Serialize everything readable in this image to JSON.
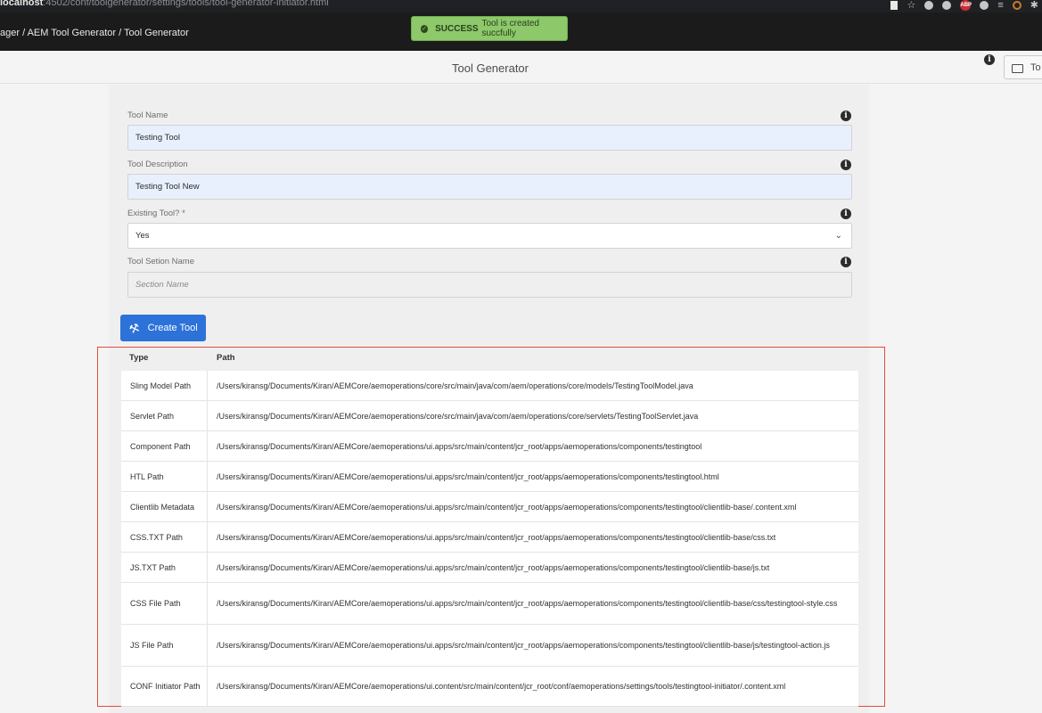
{
  "browser": {
    "url_host": "localhost",
    "url_rest": ":4502/conf/toolgenerator/settings/tools/tool-generator-initiator.html"
  },
  "nav": {
    "breadcrumb": "ager / AEM Tool Generator / Tool Generator"
  },
  "toast": {
    "title": "SUCCESS",
    "message": "Tool is created succfully"
  },
  "header": {
    "title": "Tool Generator",
    "tools_label": "To"
  },
  "form": {
    "tool_name_label": "Tool Name",
    "tool_name_value": "Testing Tool",
    "tool_description_label": "Tool Description",
    "tool_description_value": "Testing Tool New",
    "existing_tool_label": "Existing Tool? *",
    "existing_tool_value": "Yes",
    "section_name_label": "Tool Setion Name",
    "section_name_placeholder": "Section Name",
    "create_button_label": "Create Tool"
  },
  "table": {
    "columns": [
      "Type",
      "Path"
    ],
    "rows": [
      {
        "type": "Sling Model Path",
        "path": "/Users/kiransg/Documents/Kiran/AEMCore/aemoperations/core/src/main/java/com/aem/operations/core/models/TestingToolModel.java"
      },
      {
        "type": "Servlet Path",
        "path": "/Users/kiransg/Documents/Kiran/AEMCore/aemoperations/core/src/main/java/com/aem/operations/core/servlets/TestingToolServlet.java"
      },
      {
        "type": "Component Path",
        "path": "/Users/kiransg/Documents/Kiran/AEMCore/aemoperations/ui.apps/src/main/content/jcr_root/apps/aemoperations/components/testingtool"
      },
      {
        "type": "HTL Path",
        "path": "/Users/kiransg/Documents/Kiran/AEMCore/aemoperations/ui.apps/src/main/content/jcr_root/apps/aemoperations/components/testingtool.html"
      },
      {
        "type": "Clientlib Metadata",
        "path": "/Users/kiransg/Documents/Kiran/AEMCore/aemoperations/ui.apps/src/main/content/jcr_root/apps/aemoperations/components/testingtool/clientlib-base/.content.xml"
      },
      {
        "type": "CSS.TXT Path",
        "path": "/Users/kiransg/Documents/Kiran/AEMCore/aemoperations/ui.apps/src/main/content/jcr_root/apps/aemoperations/components/testingtool/clientlib-base/css.txt"
      },
      {
        "type": "JS.TXT Path",
        "path": "/Users/kiransg/Documents/Kiran/AEMCore/aemoperations/ui.apps/src/main/content/jcr_root/apps/aemoperations/components/testingtool/clientlib-base/js.txt"
      },
      {
        "type": "CSS File Path",
        "path": "/Users/kiransg/Documents/Kiran/AEMCore/aemoperations/ui.apps/src/main/content/jcr_root/apps/aemoperations/components/testingtool/clientlib-base/css/testingtool-style.css"
      },
      {
        "type": "JS File Path",
        "path": "/Users/kiransg/Documents/Kiran/AEMCore/aemoperations/ui.apps/src/main/content/jcr_root/apps/aemoperations/components/testingtool/clientlib-base/js/testingtool-action.js"
      },
      {
        "type": "CONF Initiator Path",
        "path": "/Users/kiransg/Documents/Kiran/AEMCore/aemoperations/ui.content/src/main/content/jcr_root/conf/aemoperations/settings/tools/testingtool-initiator/.content.xml"
      }
    ]
  }
}
